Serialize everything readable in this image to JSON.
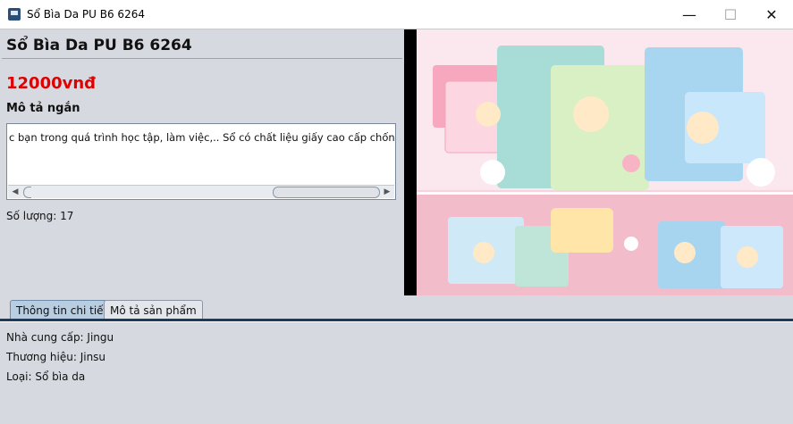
{
  "window": {
    "title": "Sổ Bìa Da PU B6 6264",
    "min_glyph": "—",
    "max_glyph": "☐",
    "close_glyph": "✕"
  },
  "product": {
    "title": "Sổ Bìa Da PU B6 6264",
    "price": "12000vnđ",
    "short_desc_label": "Mô tả ngắn",
    "short_desc_text": "c bạn trong quá trình học tập, làm việc,.. Sổ có chất liệu giấy cao cấp chống lóa...",
    "quantity": "Số lượng: 17"
  },
  "tabs": [
    {
      "label": "Thông tin chi tiết",
      "active": true
    },
    {
      "label": "Mô tả sản phẩm",
      "active": false
    }
  ],
  "details": {
    "supplier": "Nhà cung cấp: Jingu",
    "brand": "Thương hiệu: Jinsu",
    "type": "Loại: Sổ bìa da"
  },
  "colors": {
    "price": "#e00000",
    "active_tab": "#b9cde0",
    "tab_line": "#1b3a5e"
  }
}
